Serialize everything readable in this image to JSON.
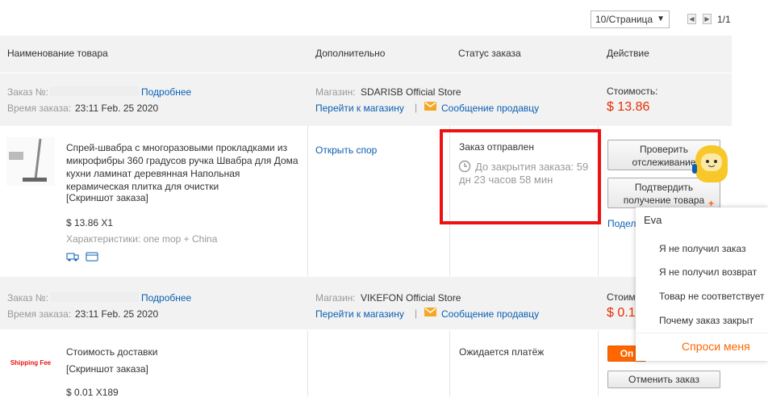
{
  "pagination": {
    "per_page": "10/Страница",
    "page": "1/1"
  },
  "columns": {
    "product": "Наименование товара",
    "extra": "Дополнительно",
    "status": "Статус заказа",
    "action": "Действие"
  },
  "orders": [
    {
      "order_label": "Заказ №:",
      "details_link": "Подробнее",
      "time_label": "Время заказа:",
      "time_value": "23:11 Feb. 25 2020",
      "store_label": "Магазин:",
      "store_name": "SDARISB Official Store",
      "go_store": "Перейти к магазину",
      "message_seller": "Сообщение продавцу",
      "cost_label": "Стоимость:",
      "cost_value": "$ 13.86",
      "product_title": "Спрей-швабра с многоразовыми прокладками из микрофибры 360 градусов ручка Швабра для Дома кухни ламинат деревянная Напольная керамическая плитка для очистки",
      "screenshot": "[Скриншот заказа]",
      "price_qty": "$ 13.86 X1",
      "specs": "Характеристики: one mop + China",
      "open_dispute": "Открыть спор",
      "status": "Заказ отправлен",
      "countdown": "До закрытия заказа: 59 дн 23 часов 58 мин",
      "btn_track": "Проверить отслеживание",
      "btn_confirm": "Подтвердить получение товара",
      "share": "Подел"
    },
    {
      "order_label": "Заказ №:",
      "details_link": "Подробнее",
      "time_label": "Время заказа:",
      "time_value": "23:11 Feb. 25 2020",
      "store_label": "Магазин:",
      "store_name": "VIKEFON Official Store",
      "go_store": "Перейти к магазину",
      "message_seller": "Сообщение продавцу",
      "cost_label": "Стоим",
      "cost_value": "$ 0.1",
      "product_title": "Стоимость доставки",
      "screenshot": "[Скриншот заказа]",
      "price_qty": "$ 0.01 X189",
      "thumb_text": "Shipping Fee",
      "status": "Ожидается платёж",
      "btn_pay": "Оп",
      "btn_cancel": "Отменить заказ"
    }
  ],
  "chat": {
    "name": "Eva",
    "options": [
      "Я не получил заказ",
      "Я не получил возврат",
      "Товар не соответствует",
      "Почему заказ закрыт"
    ],
    "ask": "Спроси меня"
  },
  "colors": {
    "accent": "#e62e04",
    "link": "#0a5fb3",
    "highlight": "#ee1111",
    "orange": "#ff6600"
  }
}
